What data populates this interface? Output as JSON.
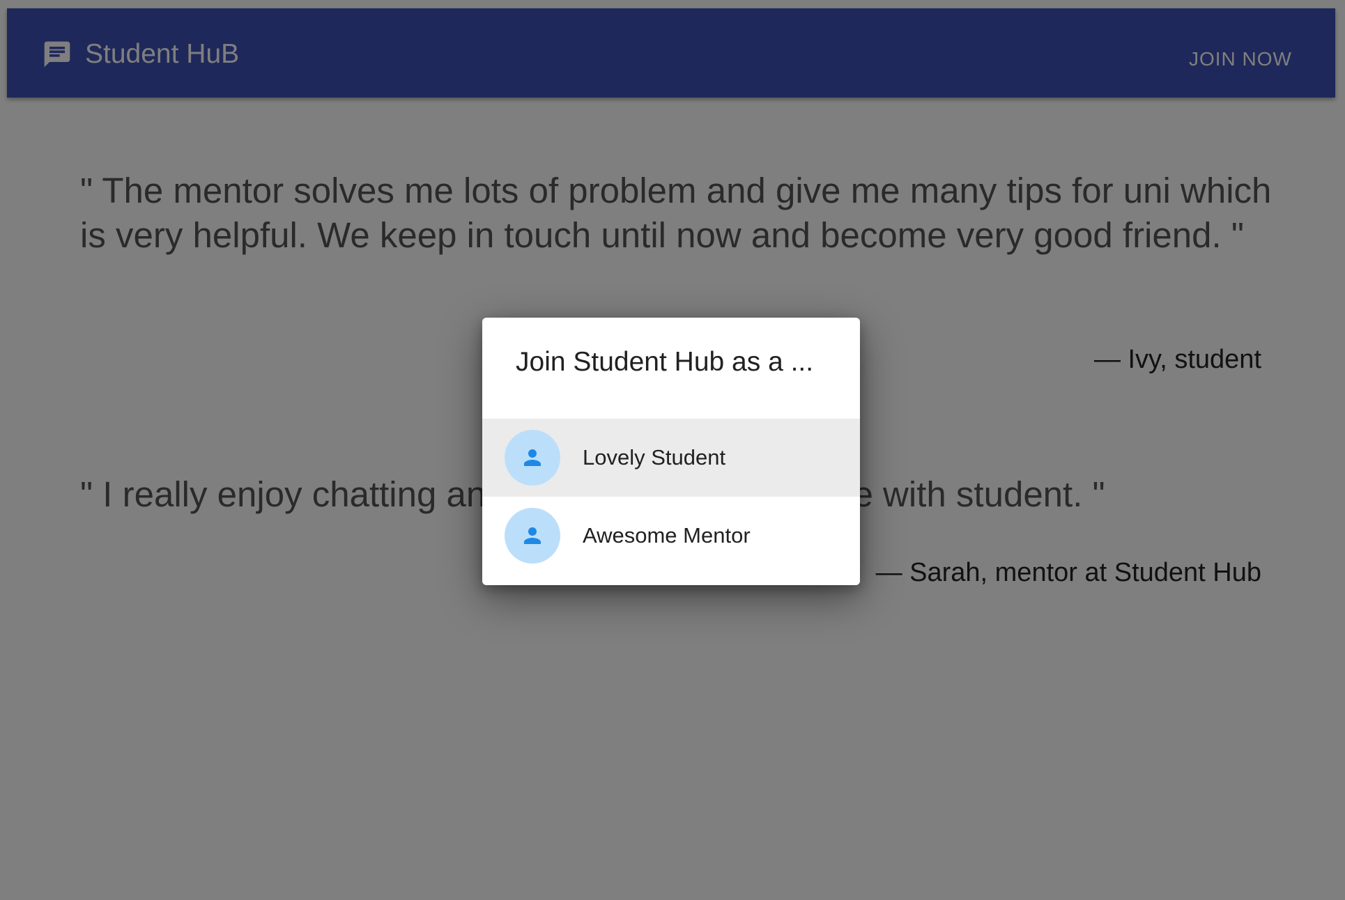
{
  "appbar": {
    "title": "Student HuB",
    "brand_icon": "chat-bubble-icon",
    "join_label": "JOIN NOW",
    "bg_color": "#3f51b5"
  },
  "testimonials": [
    {
      "quote": "\" The mentor solves me lots of problem and give me many tips for uni which is very helpful. We keep in touch until now and become very good friend. \"",
      "author": "— Ivy, student"
    },
    {
      "quote": "\" I really enjoy chatting and sharing my experience with student. \"",
      "author": "— Sarah, mentor at Student Hub"
    }
  ],
  "dialog": {
    "title": "Join Student Hub as a ...",
    "options": [
      {
        "label": "Lovely Student",
        "icon": "person-icon",
        "selected": true
      },
      {
        "label": "Awesome Mentor",
        "icon": "person-icon",
        "selected": false
      }
    ],
    "avatar_bg": "#bbdefb",
    "avatar_icon_color": "#1e88e5"
  }
}
